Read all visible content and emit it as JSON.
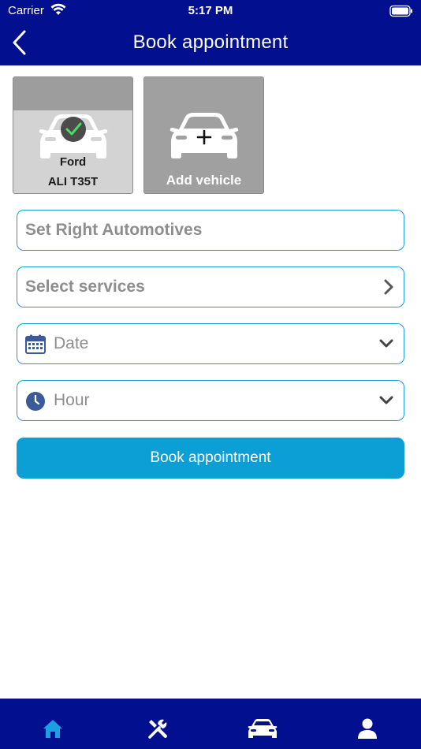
{
  "status_bar": {
    "carrier": "Carrier",
    "time": "5:17 PM"
  },
  "nav": {
    "title": "Book appointment",
    "back_icon": "chevron-left-icon"
  },
  "vehicles": [
    {
      "make": "Ford",
      "plate": "ALI T35T",
      "selected": true,
      "icon": "car-check-icon"
    },
    {
      "label": "Add vehicle",
      "icon": "car-plus-icon"
    }
  ],
  "form": {
    "workshop_value": "Set Right Automotives",
    "services_placeholder": "Select services",
    "date_placeholder": "Date",
    "hour_placeholder": "Hour"
  },
  "submit_label": "Book appointment",
  "tabbar": {
    "tabs": [
      {
        "icon": "home-icon",
        "active": true
      },
      {
        "icon": "tools-icon"
      },
      {
        "icon": "car-icon"
      },
      {
        "icon": "user-icon"
      }
    ]
  },
  "colors": {
    "brand": "#020f8f",
    "accent": "#0c9fd6",
    "border": "#19a0d4",
    "active_tab": "#1aa0e0",
    "check": "#4cd964"
  }
}
